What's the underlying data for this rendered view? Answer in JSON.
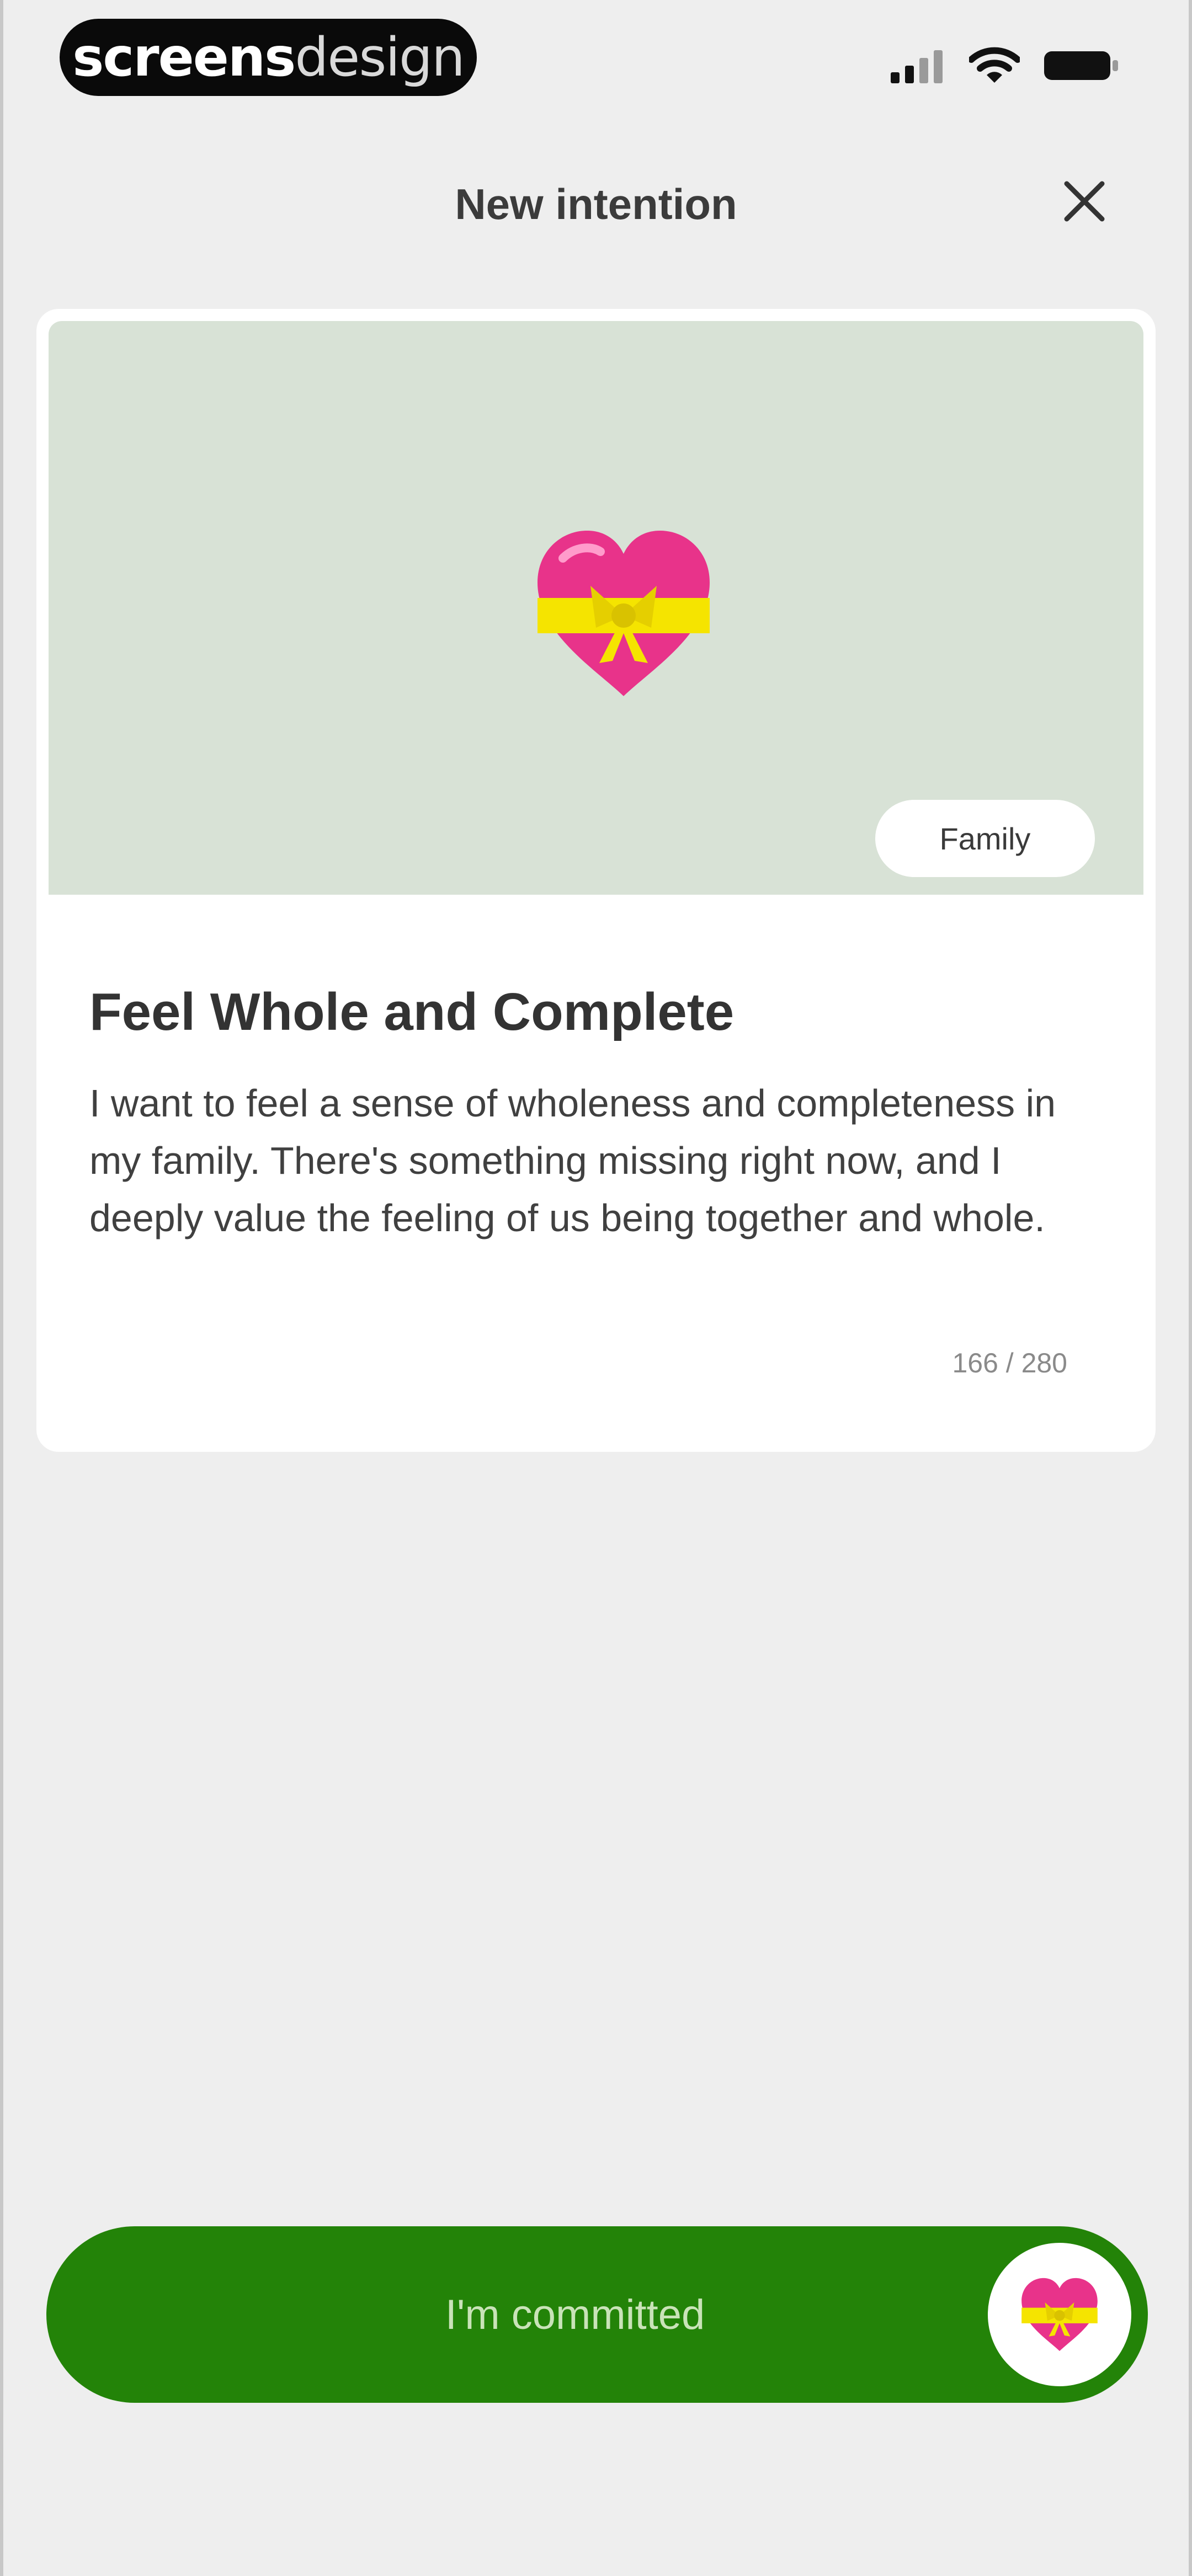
{
  "status_bar": {
    "brand_part1": "screens",
    "brand_part2": "design"
  },
  "header": {
    "title": "New intention"
  },
  "card": {
    "tag": "Family",
    "title": "Feel Whole and Complete",
    "body": "I want to feel a sense of wholeness and completeness in my family. There's something missing right now, and I deeply value the feeling of us being together and whole.",
    "char_count": "166 / 280",
    "hero_icon": "heart-with-ribbon-icon"
  },
  "commit": {
    "label": "I'm committed",
    "icon": "heart-with-ribbon-icon"
  },
  "colors": {
    "background": "#eeeeee",
    "hero_bg": "#d8e2d6",
    "accent_green": "#238308",
    "heart_pink": "#e8338a",
    "ribbon_yellow": "#f5e400"
  }
}
